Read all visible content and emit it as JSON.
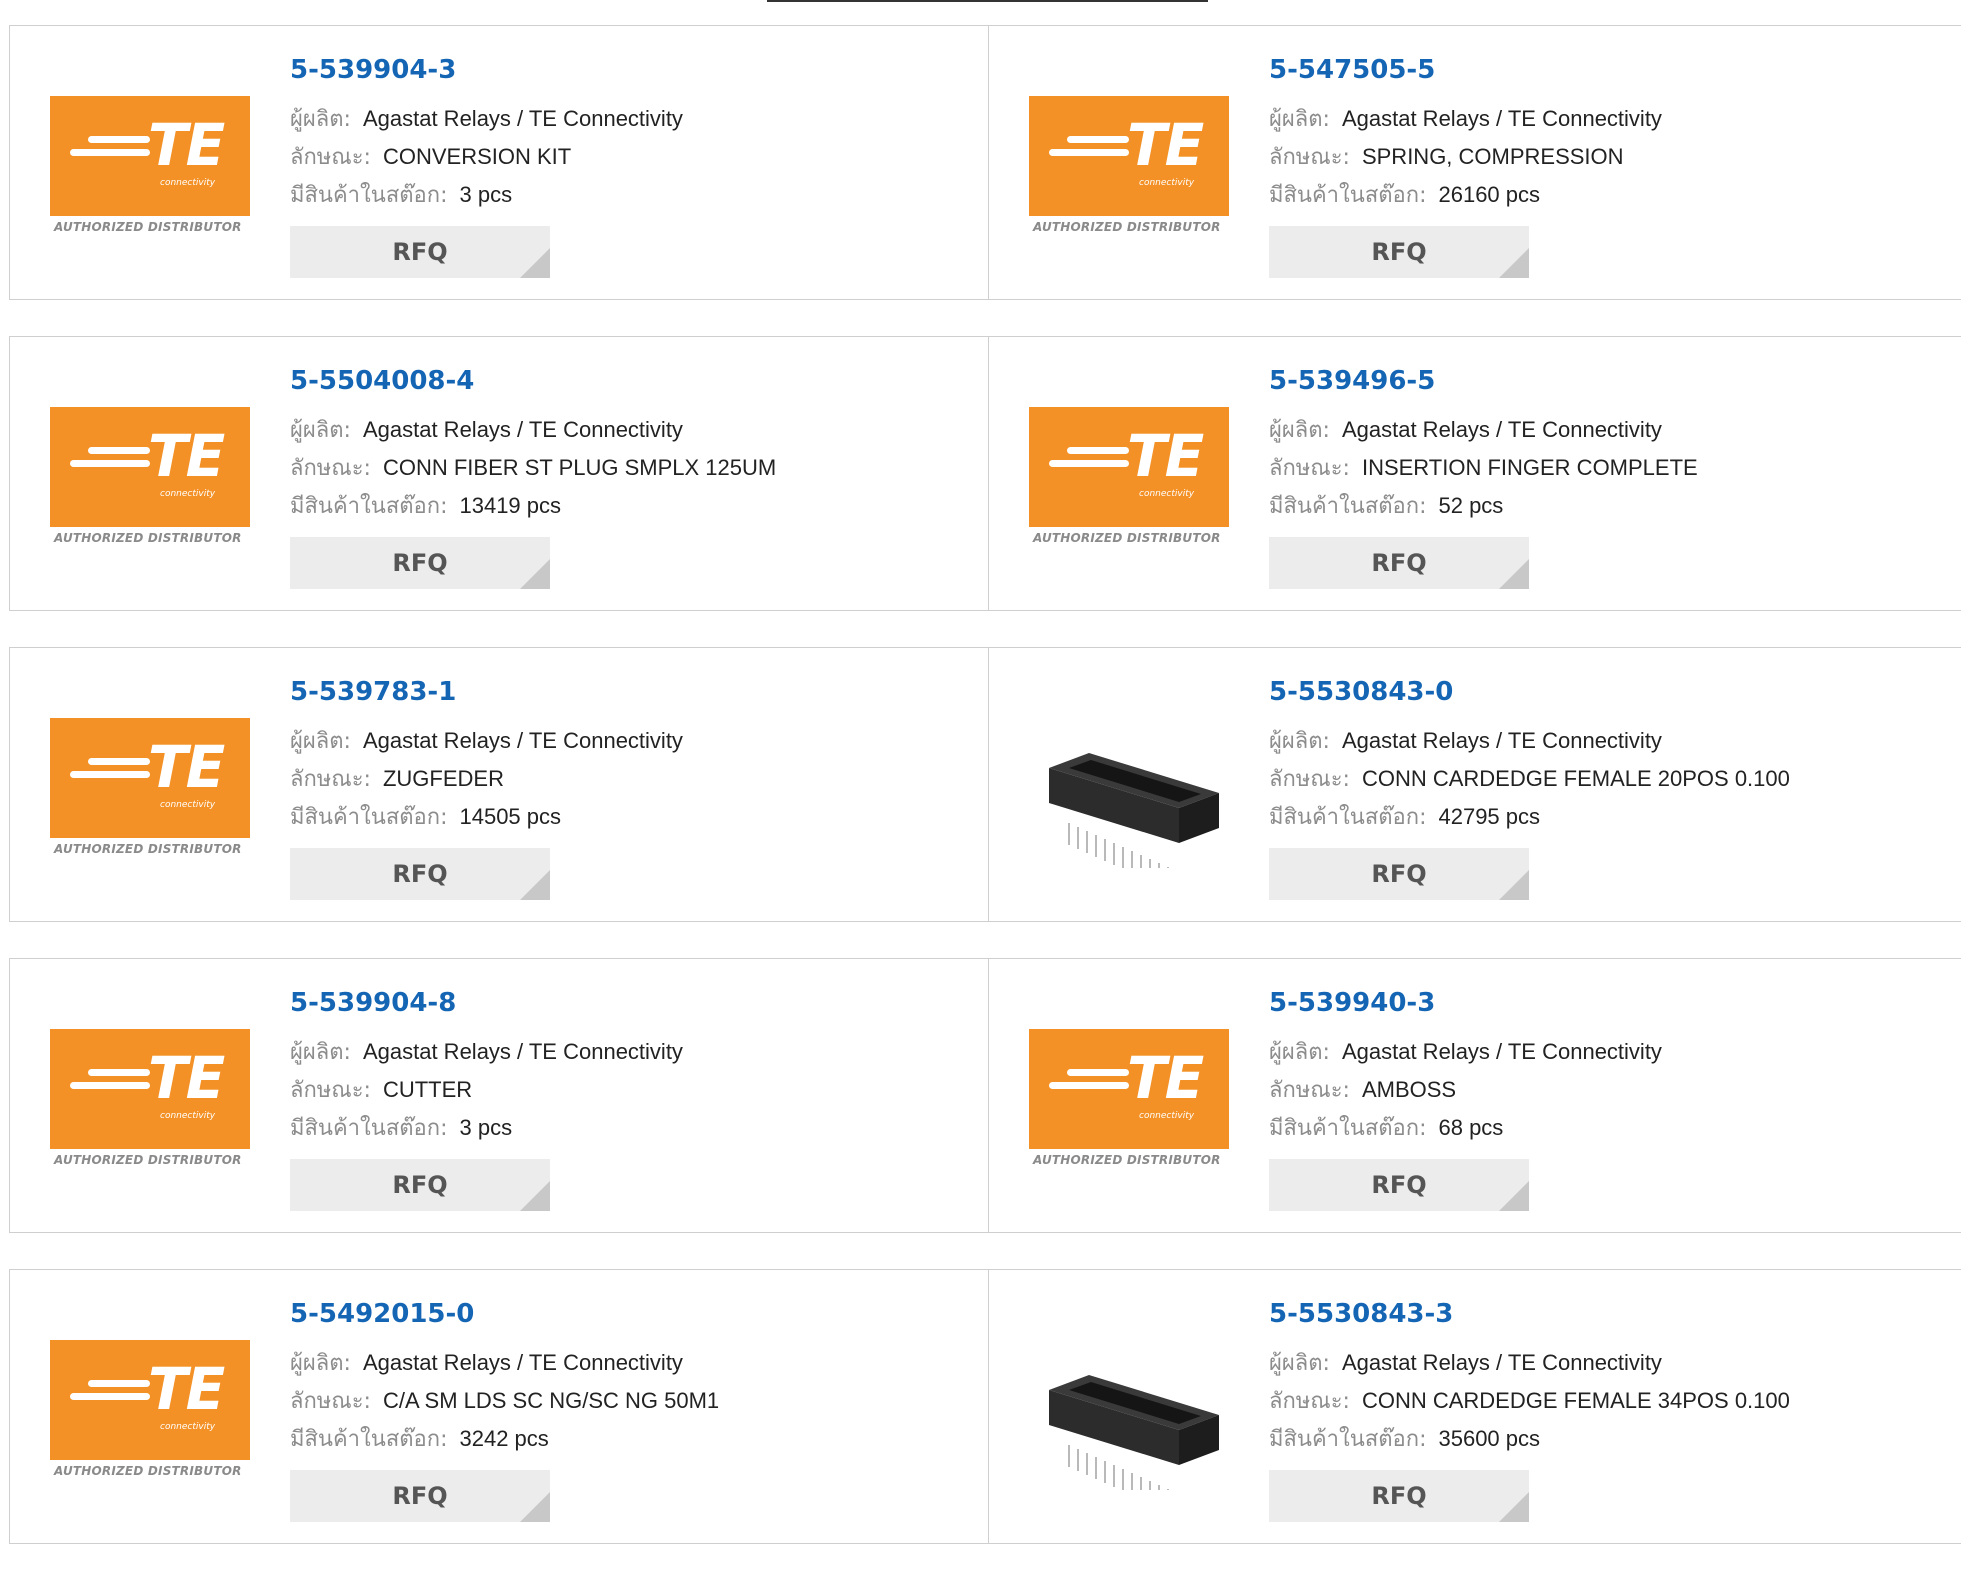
{
  "labels": {
    "manufacturer": "ผู้ผลิต:",
    "description": "ลักษณะ:",
    "stock": "มีสินค้าในสต๊อก:",
    "rfq": "RFQ",
    "logo_text": "TE",
    "logo_sub": "connectivity",
    "authorized": "AUTHORIZED DISTRIBUTOR"
  },
  "colors": {
    "brand_orange": "#f39126",
    "link_blue": "#1565b5"
  },
  "products": [
    {
      "part": "5-539904-3",
      "manufacturer": "Agastat Relays / TE Connectivity",
      "description": "CONVERSION KIT",
      "stock": "3 pcs",
      "image": "te-logo"
    },
    {
      "part": "5-547505-5",
      "manufacturer": "Agastat Relays / TE Connectivity",
      "description": "SPRING, COMPRESSION",
      "stock": "26160 pcs",
      "image": "te-logo"
    },
    {
      "part": "5-5504008-4",
      "manufacturer": "Agastat Relays / TE Connectivity",
      "description": "CONN FIBER ST PLUG SMPLX 125UM",
      "stock": "13419 pcs",
      "image": "te-logo"
    },
    {
      "part": "5-539496-5",
      "manufacturer": "Agastat Relays / TE Connectivity",
      "description": "INSERTION FINGER COMPLETE",
      "stock": "52 pcs",
      "image": "te-logo"
    },
    {
      "part": "5-539783-1",
      "manufacturer": "Agastat Relays / TE Connectivity",
      "description": "ZUGFEDER",
      "stock": "14505 pcs",
      "image": "te-logo"
    },
    {
      "part": "5-5530843-0",
      "manufacturer": "Agastat Relays / TE Connectivity",
      "description": "CONN CARDEDGE FEMALE 20POS 0.100",
      "stock": "42795 pcs",
      "image": "connector"
    },
    {
      "part": "5-539904-8",
      "manufacturer": "Agastat Relays / TE Connectivity",
      "description": "CUTTER",
      "stock": "3 pcs",
      "image": "te-logo"
    },
    {
      "part": "5-539940-3",
      "manufacturer": "Agastat Relays / TE Connectivity",
      "description": "AMBOSS",
      "stock": "68 pcs",
      "image": "te-logo"
    },
    {
      "part": "5-5492015-0",
      "manufacturer": "Agastat Relays / TE Connectivity",
      "description": "C/A SM LDS SC NG/SC NG 50M1",
      "stock": "3242 pcs",
      "image": "te-logo"
    },
    {
      "part": "5-5530843-3",
      "manufacturer": "Agastat Relays / TE Connectivity",
      "description": "CONN CARDEDGE FEMALE 34POS 0.100",
      "stock": "35600 pcs",
      "image": "connector"
    }
  ]
}
